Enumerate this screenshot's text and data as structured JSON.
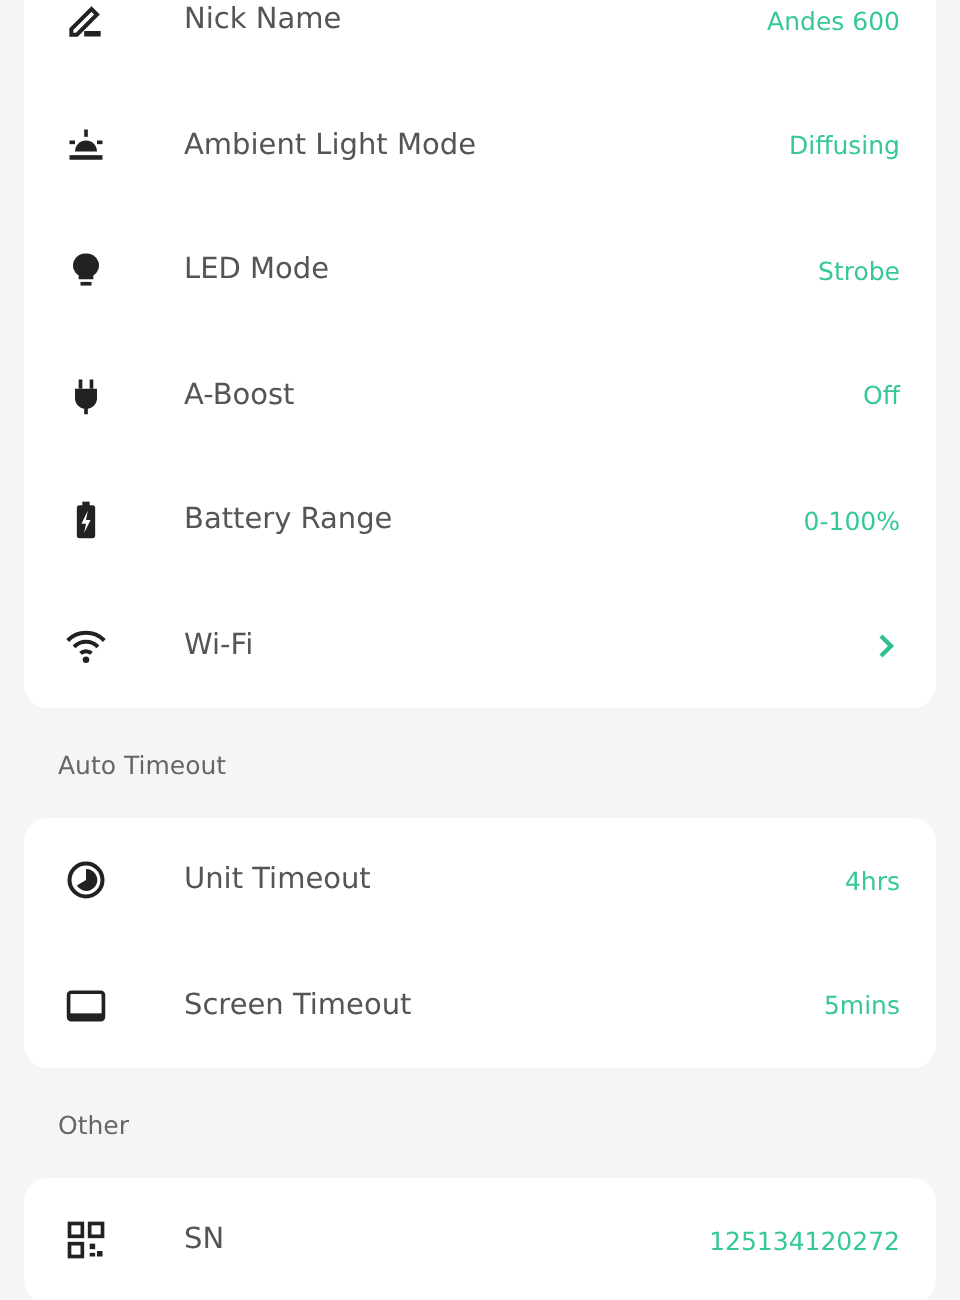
{
  "sections": [
    {
      "items": [
        {
          "kind": "value",
          "label": "Nick Name",
          "value": "Andes 600"
        },
        {
          "kind": "value",
          "label": "Ambient Light Mode",
          "value": "Diffusing"
        },
        {
          "kind": "value",
          "label": "LED Mode",
          "value": "Strobe"
        },
        {
          "kind": "value",
          "label": "A-Boost",
          "value": "Off"
        },
        {
          "kind": "value",
          "label": "Battery Range",
          "value": "0-100%"
        },
        {
          "kind": "link",
          "label": "Wi-Fi"
        }
      ]
    },
    {
      "title": "Auto Timeout",
      "items": [
        {
          "kind": "value",
          "label": "Unit Timeout",
          "value": "4hrs"
        },
        {
          "kind": "value",
          "label": "Screen Timeout",
          "value": "5mins"
        }
      ]
    },
    {
      "title": "Other",
      "items": [
        {
          "kind": "value",
          "label": "SN",
          "value": "125134120272"
        }
      ]
    }
  ]
}
